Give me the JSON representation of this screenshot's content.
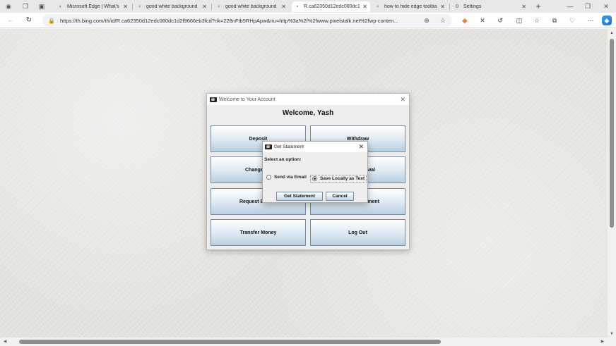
{
  "browser": {
    "tabs": [
      {
        "title": "Microsoft Edge | What's",
        "icon": "edge-icon",
        "active": false
      },
      {
        "title": "good white background",
        "icon": "search-icon",
        "active": false
      },
      {
        "title": "good white background",
        "icon": "search-icon",
        "active": false
      },
      {
        "title": "R.ca62350d12edc080dc1",
        "icon": "image-icon",
        "active": true
      },
      {
        "title": "how to hide edge toolba",
        "icon": "search-icon",
        "active": false
      },
      {
        "title": "Settings",
        "icon": "gear-icon",
        "active": false
      }
    ],
    "url": "https://th.bing.com/th/id/R.ca62350d12edc080dc1d2f9666eb3fcd?rik=228nFtb5RHpApw&riu=http%3a%2f%2fwww.pixelstalk.net%2fwp-conten..."
  },
  "app": {
    "window_title": "Welcome to Your Account",
    "welcome": "Welcome, Yash",
    "buttons": {
      "deposit": "Deposit",
      "withdraw": "Withdraw",
      "change": "Change",
      "wal": "wal",
      "request": "Request B",
      "statement": "ment",
      "transfer": "Transfer Money",
      "logout": "Log Out"
    }
  },
  "dialog": {
    "title": "Get Statement",
    "prompt": "Select an option:",
    "options": [
      {
        "label": "Send via Email",
        "selected": false
      },
      {
        "label": "Save Locally as Text",
        "selected": true
      }
    ],
    "ok_label": "Get Statement",
    "cancel_label": "Cancel"
  }
}
